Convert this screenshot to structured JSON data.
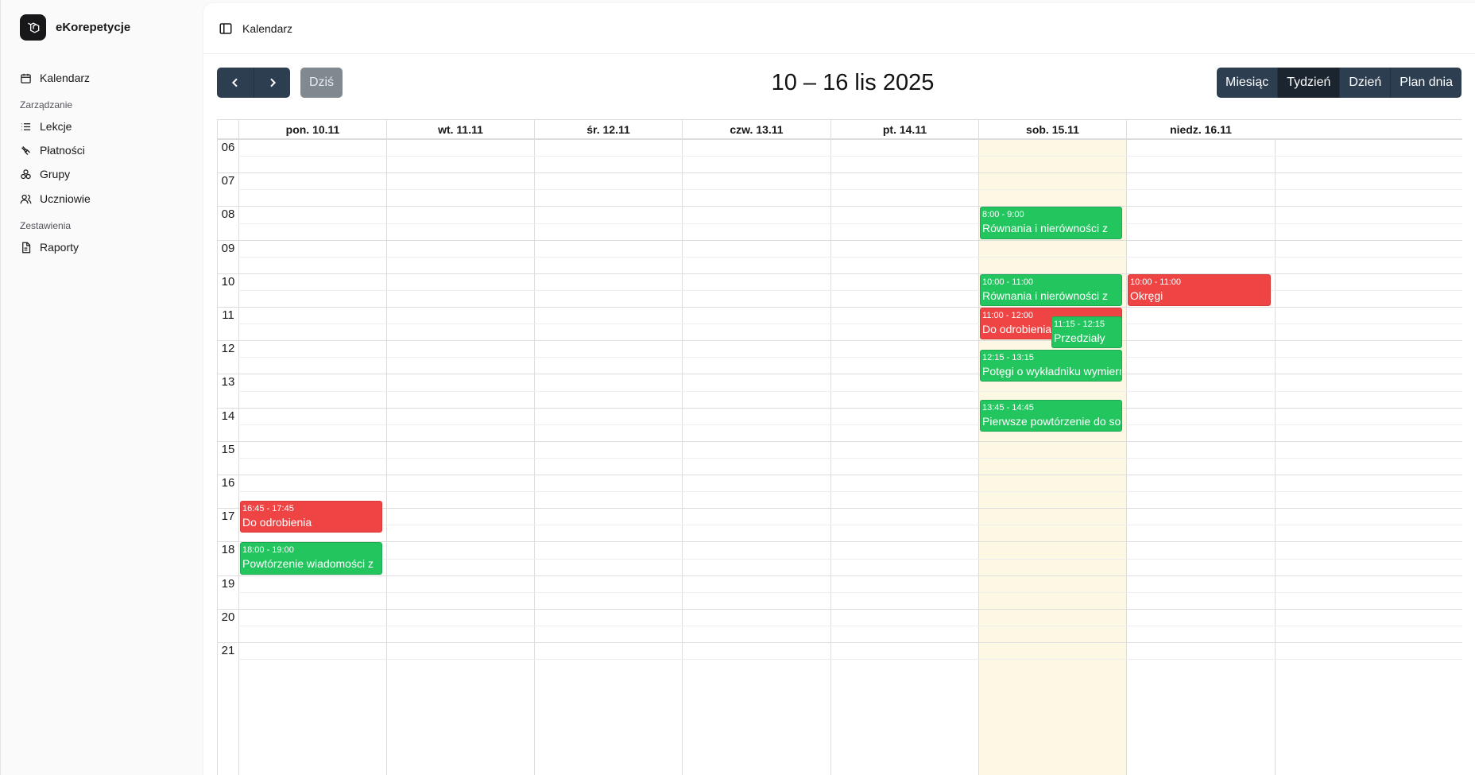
{
  "app": {
    "name": "eKorepetycje"
  },
  "sidebar": {
    "calendar_label": "Kalendarz",
    "group_manage": "Zarządzanie",
    "lessons": "Lekcje",
    "payments": "Płatności",
    "groups": "Grupy",
    "students": "Uczniowie",
    "group_reports": "Zestawienia",
    "reports": "Raporty"
  },
  "header": {
    "breadcrumb": "Kalendarz"
  },
  "toolbar": {
    "prev_icon": "chevron-left-icon",
    "next_icon": "chevron-right-icon",
    "today_label": "Dziś",
    "title": "10 – 16 lis 2025",
    "views": [
      "Miesiąc",
      "Tydzień",
      "Dzień",
      "Plan dnia"
    ],
    "active_view": "Tydzień"
  },
  "calendar": {
    "days": [
      "pon. 10.11",
      "wt. 11.11",
      "śr. 12.11",
      "czw. 13.11",
      "pt. 14.11",
      "sob. 15.11",
      "niedz. 16.11"
    ],
    "today_index": 5,
    "hours": [
      "06",
      "07",
      "08",
      "09",
      "10",
      "11",
      "12",
      "13",
      "14",
      "15",
      "16",
      "17",
      "18",
      "19",
      "20",
      "21"
    ],
    "events": [
      {
        "day": 0,
        "time": "16:45 - 17:45",
        "title": "Do odrobienia",
        "color": "red"
      },
      {
        "day": 0,
        "time": "18:00 - 19:00",
        "title": "Powtórzenie wiadomości z",
        "color": "green"
      },
      {
        "day": 5,
        "time": "8:00 - 9:00",
        "title": "Równania i nierówności z",
        "color": "green"
      },
      {
        "day": 5,
        "time": "10:00 - 11:00",
        "title": "Równania i nierówności z",
        "color": "green"
      },
      {
        "day": 5,
        "time": "11:00 - 12:00",
        "title": "Do odrobienia",
        "color": "red"
      },
      {
        "day": 5,
        "time": "11:15 - 12:15",
        "title": "Przedziały",
        "color": "green"
      },
      {
        "day": 5,
        "time": "12:15 - 13:15",
        "title": "Potęgi o wykładniku wymiernym",
        "color": "green"
      },
      {
        "day": 5,
        "time": "13:45 - 14:45",
        "title": "Pierwsze powtórzenie do soli",
        "color": "green"
      },
      {
        "day": 6,
        "time": "10:00 - 11:00",
        "title": "Okręgi",
        "color": "red"
      }
    ]
  },
  "colors": {
    "green": "#22c55e",
    "red": "#ef4444",
    "toolbar": "#2c3e50",
    "today_bg": "#fcf8e3"
  }
}
